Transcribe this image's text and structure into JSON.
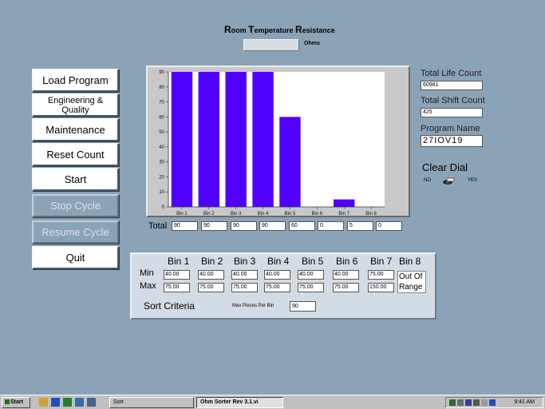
{
  "header": {
    "title_r": "R",
    "title_oom": "oom ",
    "title_t": "T",
    "title_emperature": "emperature ",
    "title_r2": "R",
    "title_esistance": "esistance",
    "unit": "Ohms"
  },
  "buttons": {
    "load_program": "Load Program",
    "engineering_quality": "Engineering & Quality",
    "maintenance": "Maintenance",
    "reset_count": "Reset Count",
    "start": "Start",
    "stop_cycle": "Stop Cycle",
    "resume_cycle": "Resume Cycle",
    "quit": "Quit"
  },
  "chart_data": {
    "type": "bar",
    "categories": [
      "Bin 1",
      "Bin 2",
      "Bin 3",
      "Bin 4",
      "Bin 5",
      "Bin 6",
      "Bin 7",
      "Bin 8"
    ],
    "values": [
      90,
      90,
      90,
      90,
      60,
      0,
      5,
      0
    ],
    "yticks": [
      0,
      10,
      20,
      30,
      40,
      50,
      60,
      70,
      80,
      90
    ],
    "ylim": [
      0,
      90
    ],
    "bar_color": "#5000ff",
    "grid": false
  },
  "totals": {
    "label": "Total",
    "values": [
      "90",
      "90",
      "90",
      "90",
      "60",
      "0",
      "5",
      "0"
    ]
  },
  "counts": {
    "lifetime_label": "Total Life Count",
    "lifetime_value": "60981",
    "shift_label": "Total Shift Count",
    "shift_value": "425",
    "program_label": "Program Name",
    "program_value": "27IOV19"
  },
  "clear_dial": {
    "label": "Clear Dial",
    "no": "NO",
    "yes": "YES"
  },
  "sort": {
    "bins": [
      "Bin 1",
      "Bin 2",
      "Bin 3",
      "Bin 4",
      "Bin 5",
      "Bin 6",
      "Bin 7",
      "Bin 8"
    ],
    "min_label": "Min",
    "max_label": "Max",
    "min_values": [
      "40.00",
      "40.00",
      "40.00",
      "40.00",
      "40.00",
      "40.00",
      "75.00"
    ],
    "max_values": [
      "75.00",
      "75.00",
      "75.00",
      "75.00",
      "75.00",
      "75.00",
      "150.00"
    ],
    "out_of_range_1": "Out Of",
    "out_of_range_2": "Range",
    "criteria_label": "Sort Criteria",
    "max_pieces_label": "Max Pieces Per Bin",
    "max_pieces_value": "90"
  },
  "taskbar": {
    "start": "Start",
    "task1": "Sort",
    "task2": "Ohm Sorter Rev 3.1.vi",
    "clock": "9:41 AM"
  }
}
